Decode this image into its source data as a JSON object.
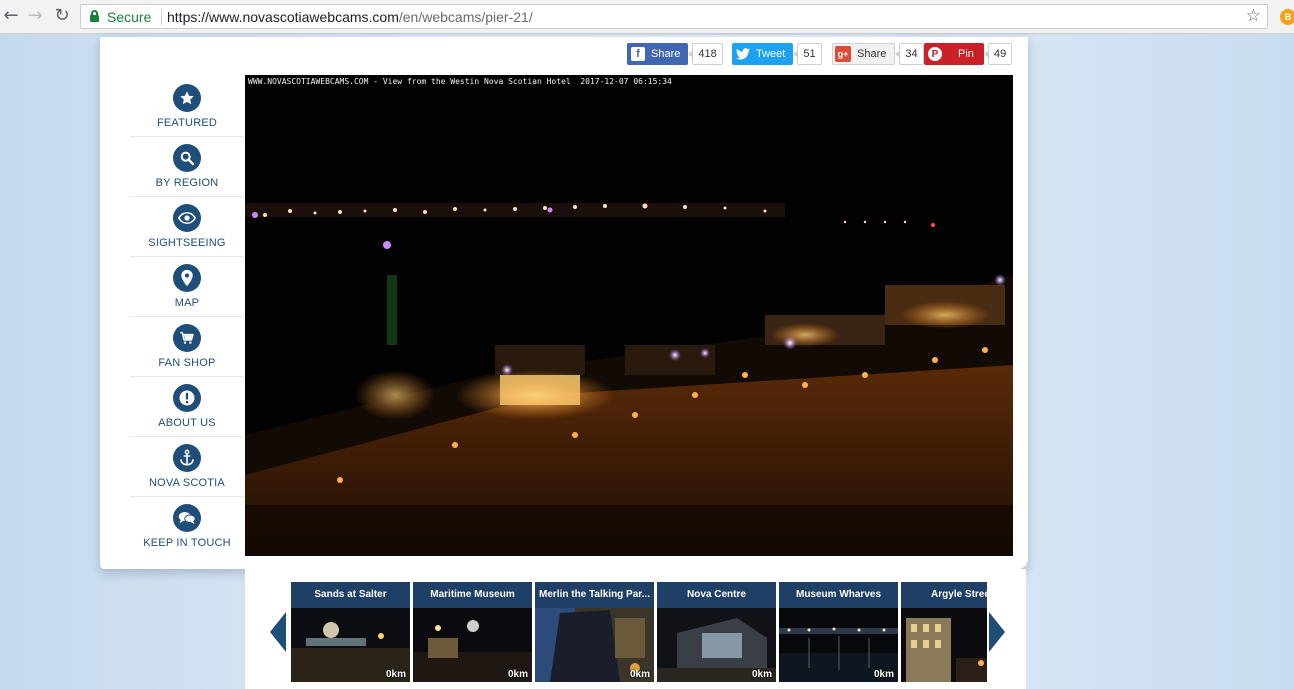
{
  "browser": {
    "secure_label": "Secure",
    "url_host": "https://www.novascotiawebcams.com",
    "url_path": "/en/webcams/pier-21/"
  },
  "social": {
    "facebook": {
      "label": "Share",
      "count": "418"
    },
    "twitter": {
      "label": "Tweet",
      "count": "51"
    },
    "googleplus": {
      "label": "Share",
      "count": "34"
    },
    "pinterest": {
      "label": "Pin",
      "count": "49"
    }
  },
  "nav": {
    "items": [
      {
        "label": "FEATURED",
        "icon": "star-icon"
      },
      {
        "label": "BY REGION",
        "icon": "magnifier-icon"
      },
      {
        "label": "SIGHTSEEING",
        "icon": "eye-icon"
      },
      {
        "label": "MAP",
        "icon": "map-pin-icon"
      },
      {
        "label": "FAN SHOP",
        "icon": "cart-icon"
      },
      {
        "label": "ABOUT US",
        "icon": "exclamation-icon"
      },
      {
        "label": "NOVA SCOTIA",
        "icon": "anchor-icon"
      },
      {
        "label": "KEEP IN TOUCH",
        "icon": "chat-bubbles-icon"
      }
    ]
  },
  "webcam": {
    "overlay": "WWW.NOVASCOTIAWEBCAMS.COM - View from the Westin Nova Scotian Hotel  2017-12-07 06:15:34"
  },
  "thumbnails": [
    {
      "title": "Sands at Salter",
      "distance": "0km"
    },
    {
      "title": "Maritime Museum",
      "distance": "0km"
    },
    {
      "title": "Merlin the Talking Par...",
      "distance": "0km"
    },
    {
      "title": "Nova Centre",
      "distance": "0km"
    },
    {
      "title": "Museum Wharves",
      "distance": "0km"
    },
    {
      "title": "Argyle Stree",
      "distance": ""
    }
  ],
  "colors": {
    "nav_blue": "#1f4e79",
    "thumb_header": "#1f3f66",
    "facebook": "#4267b2",
    "twitter": "#1da1f2",
    "pinterest": "#cb2027"
  }
}
